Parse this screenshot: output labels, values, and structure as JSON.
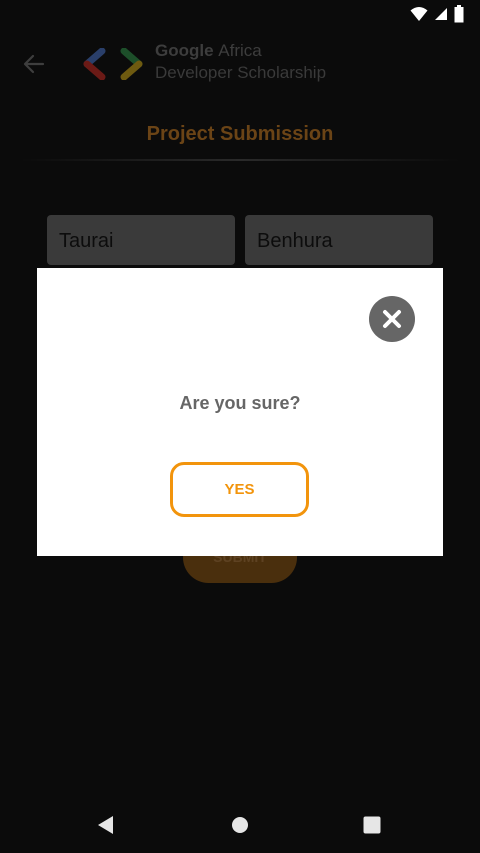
{
  "status_bar": {
    "icons": [
      "wifi-icon",
      "cellular-signal-icon",
      "battery-icon"
    ]
  },
  "header": {
    "brand_line1_bold": "Google",
    "brand_line1_light": "Africa",
    "brand_line2": "Developer Scholarship",
    "logo": "google-developers-logo"
  },
  "page": {
    "title": "Project Submission"
  },
  "form": {
    "first_name": "Taurai",
    "last_name": "Benhura",
    "submit_label": "SUBMIT"
  },
  "dialog": {
    "message": "Are you sure?",
    "confirm_label": "YES"
  },
  "colors": {
    "accent": "#f2940c",
    "title_dimmed": "#6b4416",
    "dialog_bg": "#ffffff",
    "close_bg": "#666666"
  },
  "nav_bar": {
    "icons": [
      "nav-back-icon",
      "nav-home-icon",
      "nav-recents-icon"
    ]
  }
}
